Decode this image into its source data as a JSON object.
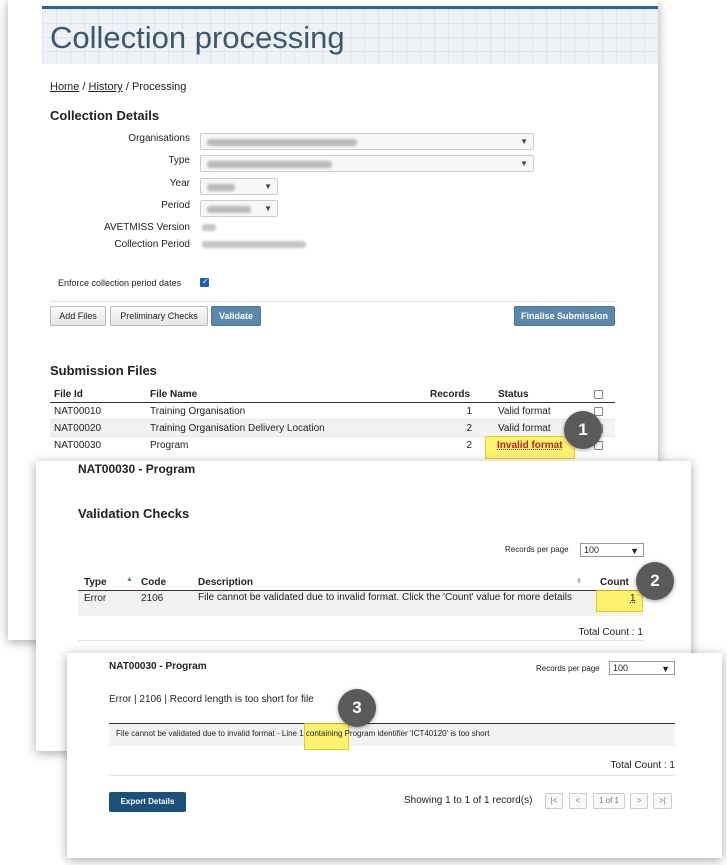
{
  "main": {
    "title": "Collection processing",
    "breadcrumb": {
      "home": "Home",
      "history": "History",
      "current": "Processing",
      "sep": "/"
    },
    "details_heading": "Collection Details",
    "labels": {
      "organisations": "Organisations",
      "type": "Type",
      "year": "Year",
      "period": "Period",
      "avetmiss": "AVETMISS Version",
      "collection_period": "Collection Period",
      "enforce": "Enforce collection period dates"
    },
    "buttons": {
      "add_files": "Add Files",
      "preliminary": "Preliminary Checks",
      "validate": "Validate",
      "finalise": "Finalise Submission"
    },
    "files_heading": "Submission Files",
    "files_columns": [
      "File Id",
      "File Name",
      "Records",
      "Status"
    ],
    "files": [
      {
        "id": "NAT00010",
        "name": "Training Organisation",
        "records": "1",
        "status": "Valid format"
      },
      {
        "id": "NAT00020",
        "name": "Training Organisation Delivery Location",
        "records": "2",
        "status": "Valid format"
      },
      {
        "id": "NAT00030",
        "name": "Program",
        "records": "2",
        "status": "Invalid format"
      }
    ]
  },
  "validation": {
    "title": "NAT00030 - Program",
    "heading": "Validation Checks",
    "rpp_label": "Records per page",
    "rpp_value": "100",
    "columns": [
      "Type",
      "Code",
      "Description",
      "Count"
    ],
    "row": {
      "type": "Error",
      "code": "2106",
      "description": "File cannot be validated due to invalid format. Click the 'Count' value for more details",
      "count": "1"
    },
    "total": "Total Count : 1"
  },
  "detail": {
    "title": "NAT00030 - Program",
    "rpp_label": "Records per page",
    "rpp_value": "100",
    "summary": "Error | 2106 | Record length is too short for file",
    "message": "File cannot be validated due to invalid format - Line 1 containing Program identifier 'ICT40120' is too short",
    "total": "Total Count : 1",
    "export": "Export Details",
    "showing": "Showing 1 to 1 of 1 record(s)",
    "pager": {
      "first": "|<",
      "prev": "<",
      "page": "1 of 1",
      "next": ">",
      "last": ">|"
    }
  },
  "badges": [
    "1",
    "2",
    "3"
  ],
  "colors": {
    "title": "#3d566e",
    "accent": "#2a6496",
    "highlight": "#fff35a",
    "primary_btn": "#1d4f7c",
    "badge": "#5a5a5a"
  }
}
